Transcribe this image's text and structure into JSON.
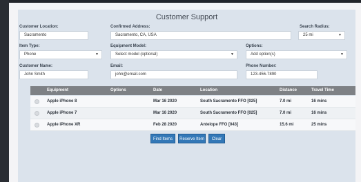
{
  "app": {
    "title": "Customer Support"
  },
  "form": {
    "customer_location": {
      "label": "Customer Location:",
      "value": "Sacramento"
    },
    "confirmed_address": {
      "label": "Confirmed Address:",
      "value": "Sacramento, CA, USA"
    },
    "search_radius": {
      "label": "Search Radius:",
      "value": "25 mi"
    },
    "item_type": {
      "label": "Item Type:",
      "value": "Phone"
    },
    "equipment_model": {
      "label": "Equipment Model:",
      "value": "Select model (optional)"
    },
    "options": {
      "label": "Options:",
      "value": "Add option(s)"
    },
    "customer_name": {
      "label": "Customer Name:",
      "value": "John Smith"
    },
    "email": {
      "label": "Email:",
      "value": "john@email.com"
    },
    "phone": {
      "label": "Phone Number:",
      "value": "123-456-7890"
    }
  },
  "table": {
    "columns": [
      "Equipment",
      "Options",
      "Date",
      "Location",
      "Distance",
      "Travel Time"
    ],
    "rows": [
      {
        "equipment": "Apple iPhone 8",
        "options": "",
        "date": "Mar 16 2020",
        "location": "South Sacramento FFO [025]",
        "distance": "7.0 mi",
        "travel_time": "16 mins"
      },
      {
        "equipment": "Apple iPhone 7",
        "options": "",
        "date": "Mar 16 2020",
        "location": "South Sacramento FFO [025]",
        "distance": "7.0 mi",
        "travel_time": "16 mins"
      },
      {
        "equipment": "Apple iPhone XR",
        "options": "",
        "date": "Feb 28 2020",
        "location": "Antelope FFO [043]",
        "distance": "15.6 mi",
        "travel_time": "25 mins"
      }
    ]
  },
  "buttons": {
    "find": "Find Items",
    "reserve": "Reserve Item",
    "clear": "Clear"
  },
  "icons": {
    "select_caret": "chevron-down-icon",
    "row_select": "radio-icon"
  },
  "colors": {
    "accent": "#3378b7",
    "header": "#7e8185",
    "panel": "#dbe3ec",
    "sidebar": "#2a2d33"
  }
}
